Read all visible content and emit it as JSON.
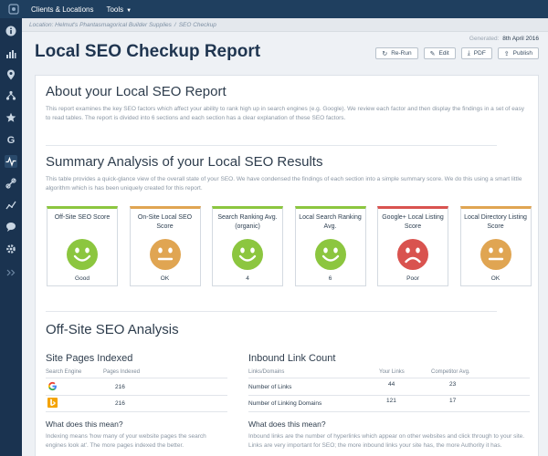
{
  "nav": {
    "menu_clients": "Clients & Locations",
    "menu_tools": "Tools"
  },
  "breadcrumb": {
    "location": "Location: Helmut's Phantasmagorical Builder Supplies",
    "current": "SEO Checkup",
    "separator": "/"
  },
  "header": {
    "title": "Local SEO Checkup Report",
    "generated_label": "Generated:",
    "generated_date": "8th April 2016",
    "buttons": {
      "rerun": "Re-Run",
      "edit": "Edit",
      "pdf": "PDF",
      "publish": "Publish"
    }
  },
  "about": {
    "heading": "About your Local SEO Report",
    "text": "This report examines the key SEO factors which affect your ability to rank high up in search engines (e.g. Google). We review each factor and then display the findings in a set of easy to read tables. The report is divided into 6 sections and each section has a clear explanation of these SEO factors."
  },
  "summary": {
    "heading": "Summary Analysis of your Local SEO Results",
    "text": "This table provides a quick-glance view of the overall state of your SEO. We have condensed the findings of each section into a simple summary score. We do this using a smart little algorithm which is has been uniquely created for this report.",
    "scores": [
      {
        "label": "Off-Site SEO Score",
        "value": "Good",
        "mood": "happy",
        "color": "#8cc63f"
      },
      {
        "label": "On-Site Local SEO Score",
        "value": "OK",
        "mood": "neutral",
        "color": "#e0a552"
      },
      {
        "label": "Search Ranking Avg. (organic)",
        "value": "4",
        "mood": "happy",
        "color": "#8cc63f"
      },
      {
        "label": "Local Search Ranking Avg.",
        "value": "6",
        "mood": "happy",
        "color": "#8cc63f"
      },
      {
        "label": "Google+ Local Listing Score",
        "value": "Poor",
        "mood": "sad",
        "color": "#d9534f"
      },
      {
        "label": "Local Directory Listing Score",
        "value": "OK",
        "mood": "neutral",
        "color": "#e0a552"
      }
    ]
  },
  "offsite": {
    "heading": "Off-Site SEO Analysis",
    "pages_indexed": {
      "heading": "Site Pages Indexed",
      "col_engine": "Search Engine",
      "col_pages": "Pages Indexed",
      "rows": [
        {
          "engine_icon": "google-icon",
          "pages": "216"
        },
        {
          "engine_icon": "bing-icon",
          "pages": "216"
        }
      ],
      "what_heading": "What does this mean?",
      "what_text": "Indexing means 'how many of your website pages the search engines look at'. The more pages indexed the better."
    },
    "inbound_links": {
      "heading": "Inbound Link Count",
      "col_links": "Links/Domains",
      "col_yours": "Your Links",
      "col_comp": "Competitor Avg.",
      "rows": [
        {
          "label": "Number of Links",
          "yours": "44",
          "comp": "23"
        },
        {
          "label": "Number of Linking Domains",
          "yours": "121",
          "comp": "17"
        }
      ],
      "what_heading": "What does this mean?",
      "what_text": "Inbound links are the number of hyperlinks which appear on other websites and click through to your site. Links are very important for SEO; the more inbound links your site has, the more Authority it has."
    }
  }
}
